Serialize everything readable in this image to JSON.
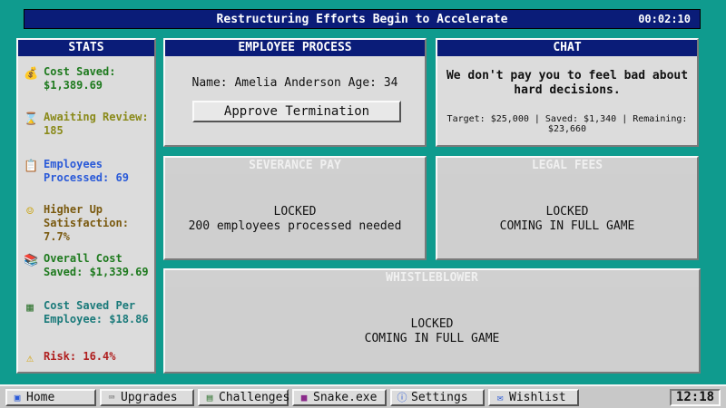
{
  "window": {
    "title": "Restructuring Efforts Begin to Accelerate",
    "timer": "00:02:10"
  },
  "stats": {
    "header": "STATS",
    "items": [
      {
        "label": "Cost Saved:",
        "value": "$1,389.69",
        "icon": "money-bag-icon",
        "color": "#1e7a1e"
      },
      {
        "label": "Awaiting Review:",
        "value": "185",
        "icon": "hourglass-icon",
        "color": "#8a8a1a"
      },
      {
        "label": "Employees",
        "value": "Processed: 69",
        "icon": "clipboard-icon",
        "color": "#2a5ad8"
      },
      {
        "label": "Higher Up",
        "value": "Satisfaction: 7.7%",
        "icon": "smiley-icon",
        "color": "#7a5a10"
      },
      {
        "label": "Overall Cost",
        "value": "Saved: $1,339.69",
        "icon": "books-icon",
        "color": "#1e7a1e"
      },
      {
        "label": "Cost Saved Per",
        "value": "Employee: $18.86",
        "icon": "calculator-icon",
        "color": "#1a7a7a"
      },
      {
        "label": "Risk: 16.4%",
        "value": "",
        "icon": "warning-icon",
        "color": "#b02020"
      }
    ]
  },
  "employee": {
    "header": "EMPLOYEE PROCESS",
    "name_line": "Name: Amelia Anderson  Age: 34",
    "button": "Approve Termination"
  },
  "chat": {
    "header": "CHAT",
    "message": "We don't pay you to feel bad about hard decisions.",
    "targets": "Target: $25,000 | Saved: $1,340 | Remaining: $23,660"
  },
  "severance": {
    "header": "SEVERANCE PAY",
    "line1": "LOCKED",
    "line2": "200 employees processed needed"
  },
  "legal": {
    "header": "LEGAL FEES",
    "line1": "LOCKED",
    "line2": "COMING IN FULL GAME"
  },
  "whistle": {
    "header": "WHISTLEBLOWER",
    "line1": "LOCKED",
    "line2": "COMING IN FULL GAME"
  },
  "taskbar": {
    "items": [
      {
        "label": "Home",
        "icon": "home-icon"
      },
      {
        "label": "Upgrades",
        "icon": "upgrades-icon"
      },
      {
        "label": "Challenges",
        "icon": "challenges-icon"
      },
      {
        "label": "Snake.exe",
        "icon": "snake-icon"
      },
      {
        "label": "Settings",
        "icon": "info-icon"
      },
      {
        "label": "Wishlist",
        "icon": "wishlist-icon"
      }
    ],
    "clock": "12:18"
  }
}
